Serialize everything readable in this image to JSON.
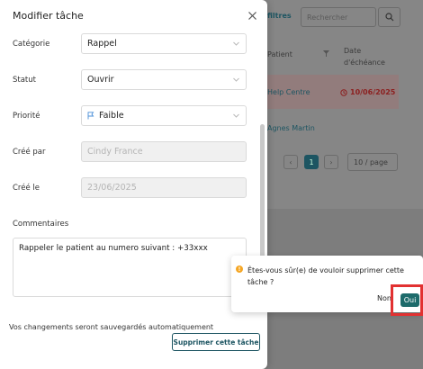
{
  "background": {
    "filter_link": "filtres",
    "search_placeholder": "Rechercher",
    "col_patient": "Patient",
    "col_date": "Date d'échéance",
    "row1_patient": "Help Centre",
    "row1_date": "10/06/2025",
    "row2_patient": "Agnes Martin",
    "page_current": "1",
    "per_page": "10 / page"
  },
  "modal": {
    "title": "Modifier tâche",
    "fields": {
      "categorie_label": "Catégorie",
      "categorie_value": "Rappel",
      "statut_label": "Statut",
      "statut_value": "Ouvrir",
      "priorite_label": "Priorité",
      "priorite_value": "Faible",
      "cree_par_label": "Créé par",
      "cree_par_value": "Cindy France",
      "cree_le_label": "Créé le",
      "cree_le_value": "23/06/2025",
      "commentaires_label": "Commentaires",
      "commentaires_value": "Rappeler le patient au numero suivant : +33xxx"
    },
    "autosave_note": "Vos changements seront sauvegardés automatiquement",
    "delete_button": "Supprimer cette tâche"
  },
  "popconfirm": {
    "message": "Êtes-vous sûr(e) de vouloir supprimer cette tâche ?",
    "cancel": "Non",
    "confirm": "Oui"
  },
  "colors": {
    "primary": "#1d6b6b",
    "highlight": "#e23131",
    "warning": "#f5a623"
  }
}
